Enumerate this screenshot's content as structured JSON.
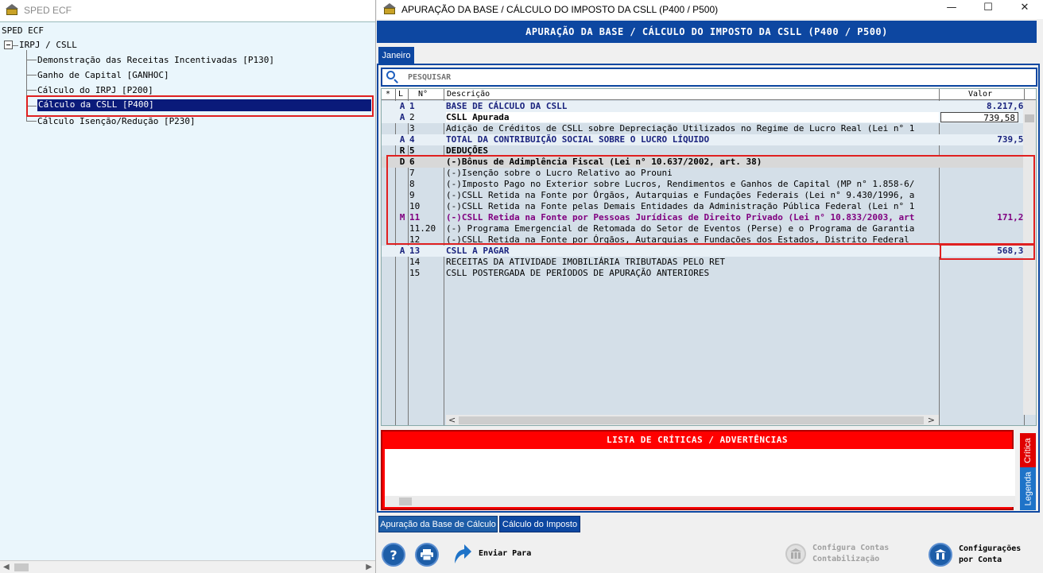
{
  "left_window": {
    "title": "SPED ECF",
    "tree": {
      "root": "SPED ECF",
      "group": "IRPJ / CSLL",
      "items": [
        "Demonstração das Receitas Incentivadas [P130]",
        "Ganho de Capital [GANHOC]",
        "Cálculo do IRPJ [P200]",
        "Cálculo da CSLL [P400]",
        "Cálculo Isenção/Redução [P230]"
      ],
      "selected_index": 3
    }
  },
  "right_window": {
    "title": "APURAÇÃO DA BASE / CÁLCULO DO IMPOSTO DA CSLL (P400 / P500)",
    "controls": {
      "minimize": "—",
      "maximize": "☐",
      "close": "✕"
    },
    "header": "APURAÇÃO DA BASE / CÁLCULO DO IMPOSTO DA CSLL (P400 / P500)",
    "month_tab": "Janeiro",
    "search": {
      "placeholder": "PESQUISAR"
    },
    "table": {
      "headers": {
        "star": "*",
        "l": "L",
        "n": "N°",
        "desc": "Descrição",
        "value": "Valor"
      },
      "rows": [
        {
          "l": "A",
          "n": "1",
          "desc": "BASE DE CÁLCULO DA CSLL",
          "value": "8.217,60",
          "style": "bold"
        },
        {
          "l": "A",
          "n": "2",
          "desc": "CSLL Apurada",
          "value": "739,58",
          "style": "white-bold"
        },
        {
          "l": "",
          "n": "3",
          "desc": "Adição de Créditos de CSLL sobre Depreciação Utilizados no Regime de Lucro Real (Lei n° 1",
          "value": "",
          "style": ""
        },
        {
          "l": "A",
          "n": "4",
          "desc": "TOTAL DA CONTRIBUIÇÃO SOCIAL SOBRE O LUCRO LÍQUIDO",
          "value": "739,58",
          "style": "bold"
        },
        {
          "l": "R",
          "n": "5",
          "desc": "DEDUÇÕES",
          "value": "",
          "style": "black-bold"
        },
        {
          "l": "D",
          "n": "6",
          "desc": "(-)Bônus de Adimplência Fiscal (Lei n° 10.637/2002, art. 38)",
          "value": "",
          "style": "grey"
        },
        {
          "l": "",
          "n": "7",
          "desc": "(-)Isenção sobre o Lucro Relativo ao Prouni",
          "value": "",
          "style": ""
        },
        {
          "l": "",
          "n": "8",
          "desc": "(-)Imposto Pago no Exterior sobre Lucros, Rendimentos e Ganhos de Capital (MP n° 1.858-6/",
          "value": "",
          "style": ""
        },
        {
          "l": "",
          "n": "9",
          "desc": "(-)CSLL Retida na Fonte por Órgãos, Autarquias e Fundações Federais (Lei n° 9.430/1996, a",
          "value": "",
          "style": ""
        },
        {
          "l": "",
          "n": "10",
          "desc": "(-)CSLL Retida na Fonte pelas Demais Entidades da Administração Pública Federal (Lei n° 1",
          "value": "",
          "style": ""
        },
        {
          "l": "M",
          "n": "11",
          "desc": "(-)CSLL Retida na Fonte por Pessoas Jurídicas de Direito Privado (Lei n° 10.833/2003, art",
          "value": "171,20",
          "style": "purple"
        },
        {
          "l": "",
          "n": "11.20",
          "desc": "(-) Programa Emergencial de Retomada do Setor de Eventos (Perse) e o Programa de Garantia",
          "value": "",
          "style": ""
        },
        {
          "l": "",
          "n": "12",
          "desc": "(-)CSLL Retida na Fonte por Órgãos, Autarquias e Fundações dos Estados, Distrito Federal",
          "value": "",
          "style": ""
        },
        {
          "l": "A",
          "n": "13",
          "desc": "CSLL A PAGAR",
          "value": "568,38",
          "style": "bold"
        },
        {
          "l": "",
          "n": "14",
          "desc": "RECEITAS DA ATIVIDADE IMOBILIÁRIA TRIBUTADAS PELO RET",
          "value": "",
          "style": ""
        },
        {
          "l": "",
          "n": "15",
          "desc": "CSLL POSTERGADA DE PERÍODOS DE APURAÇÃO ANTERIORES",
          "value": "",
          "style": ""
        }
      ]
    },
    "criticas": {
      "title": "LISTA DE CRÍTICAS / ADVERTÊNCIAS",
      "tab_critica": "Crítica",
      "tab_legenda": "Legenda"
    },
    "bottom_tabs": [
      "Apuração da Base de Cálculo",
      "Cálculo do Imposto"
    ],
    "toolbar": {
      "help_glyph": "?",
      "enviar_para": "Enviar Para",
      "configura_contas_line1": "Configura Contas",
      "configura_contas_line2": "Contabilização",
      "configuracoes_line1": "Configurações",
      "configuracoes_line2": "por Conta"
    },
    "colors": {
      "accent": "#0d47a1",
      "critical": "#ff0000",
      "purple": "#800080",
      "highlight": "#e02020"
    }
  }
}
